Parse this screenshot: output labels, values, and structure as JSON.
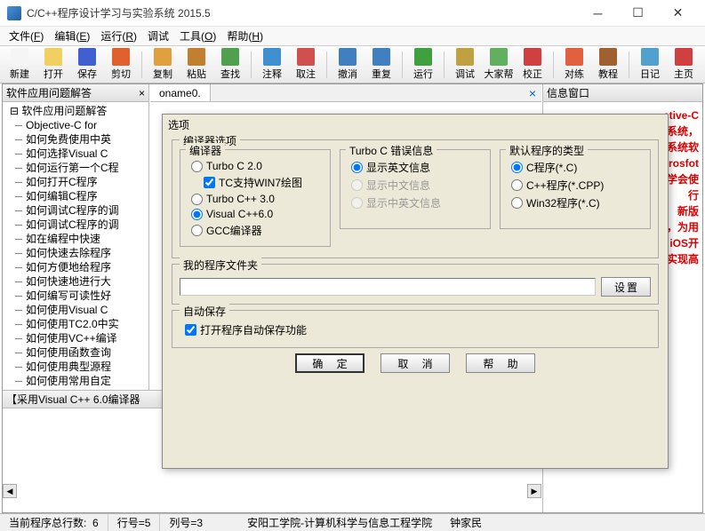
{
  "window": {
    "title": "C/C++程序设计学习与实验系统 2015.5"
  },
  "menu": [
    {
      "label": "文件",
      "key": "F"
    },
    {
      "label": "编辑",
      "key": "E"
    },
    {
      "label": "运行",
      "key": "R"
    },
    {
      "label": "调试",
      "key": ""
    },
    {
      "label": "工具",
      "key": "O"
    },
    {
      "label": "帮助",
      "key": "H"
    }
  ],
  "toolbar": [
    {
      "label": "新建",
      "color": "#f5f5f5"
    },
    {
      "label": "打开",
      "color": "#f0d060"
    },
    {
      "label": "保存",
      "color": "#4060d0"
    },
    {
      "label": "剪切",
      "color": "#e06030"
    },
    {
      "sep": true
    },
    {
      "label": "复制",
      "color": "#e0a040"
    },
    {
      "label": "粘贴",
      "color": "#c08030"
    },
    {
      "label": "查找",
      "color": "#50a050"
    },
    {
      "sep": true
    },
    {
      "label": "注释",
      "color": "#4090d0"
    },
    {
      "label": "取注",
      "color": "#d05050"
    },
    {
      "sep": true
    },
    {
      "label": "撤消",
      "color": "#4080c0"
    },
    {
      "label": "重复",
      "color": "#4080c0"
    },
    {
      "sep": true
    },
    {
      "label": "运行",
      "color": "#40a040"
    },
    {
      "sep": true
    },
    {
      "label": "调试",
      "color": "#c0a040"
    },
    {
      "label": "大家帮",
      "color": "#60b060"
    },
    {
      "label": "校正",
      "color": "#d04040"
    },
    {
      "sep": true
    },
    {
      "label": "对练",
      "color": "#e06040"
    },
    {
      "label": "教程",
      "color": "#a06030"
    },
    {
      "sep": true
    },
    {
      "label": "日记",
      "color": "#50a0d0"
    },
    {
      "label": "主页",
      "color": "#d04040"
    }
  ],
  "leftPanel": {
    "title": "软件应用问题解答",
    "treeRoot": "软件应用问题解答",
    "items": [
      "Objective-C for",
      "如何免费使用中英",
      "如何选择Visual C",
      "如何运行第一个C程",
      "如何打开C程序",
      "如何编辑C程序",
      "如何调试C程序的调",
      "如何调试C程序的调",
      "如在编程中快速",
      "如何快速去除程序",
      "如何方便地给程序",
      "如何快速地进行大",
      "如何编写可读性好",
      "如何使用Visual C",
      "如何使用TC2.0中实",
      "如何使用VC++编译",
      "如何使用函数查询",
      "如何使用典型源程",
      "如何使用常用自定"
    ]
  },
  "bottomPanel": {
    "title": "【采用Visual C++ 6.0编译器"
  },
  "centerTab": {
    "name": "oname0."
  },
  "rightPanel": {
    "title": "信息窗口",
    "lines": [
      {
        "text": "ctive-C",
        "cls": "red"
      },
      {
        "text": "验系统，",
        "cls": "red"
      },
      {
        "text": "",
        "cls": ""
      },
      {
        "text": "系统软",
        "cls": "red"
      },
      {
        "text": "icrosfot",
        "cls": "red"
      },
      {
        "text": "学会使",
        "cls": "red"
      },
      {
        "text": "行",
        "cls": "red"
      },
      {
        "text": "新版",
        "cls": "red"
      },
      {
        "text": "，为用",
        "cls": "red"
      },
      {
        "text": "iOS开",
        "cls": "red"
      },
      {
        "text": "实现高",
        "cls": "red"
      }
    ]
  },
  "dialog": {
    "title": "选项",
    "group1": "编译器选项",
    "compiler": {
      "legend": "编译器",
      "opts": [
        {
          "type": "radio",
          "label": "Turbo C 2.0",
          "checked": false
        },
        {
          "type": "check",
          "label": "TC支持WIN7绘图",
          "checked": true,
          "indent": true
        },
        {
          "type": "radio",
          "label": "Turbo C++ 3.0",
          "checked": false
        },
        {
          "type": "radio",
          "label": "Visual C++6.0",
          "checked": true
        },
        {
          "type": "radio",
          "label": "GCC编译器",
          "checked": false
        }
      ]
    },
    "errinfo": {
      "legend": "Turbo C 错误信息",
      "opts": [
        {
          "label": "显示英文信息",
          "checked": true,
          "disabled": false
        },
        {
          "label": "显示中文信息",
          "checked": false,
          "disabled": true
        },
        {
          "label": "显示中英文信息",
          "checked": false,
          "disabled": true
        }
      ]
    },
    "progtype": {
      "legend": "默认程序的类型",
      "opts": [
        {
          "label": "C程序(*.C)",
          "checked": true
        },
        {
          "label": "C++程序(*.CPP)",
          "checked": false
        },
        {
          "label": "Win32程序(*.C)",
          "checked": false
        }
      ]
    },
    "folder": {
      "legend": "我的程序文件夹",
      "value": "",
      "btn": "设置"
    },
    "autosave": {
      "legend": "自动保存",
      "label": "打开程序自动保存功能",
      "checked": true
    },
    "buttons": {
      "ok": "确 定",
      "cancel": "取 消",
      "help": "帮 助"
    }
  },
  "status": {
    "count_label": "当前程序总行数:",
    "count": "6",
    "row_label": "行号=5",
    "col_label": "列号=3",
    "school": "安阳工学院-计算机科学与信息工程学院",
    "author": "钟家民"
  }
}
